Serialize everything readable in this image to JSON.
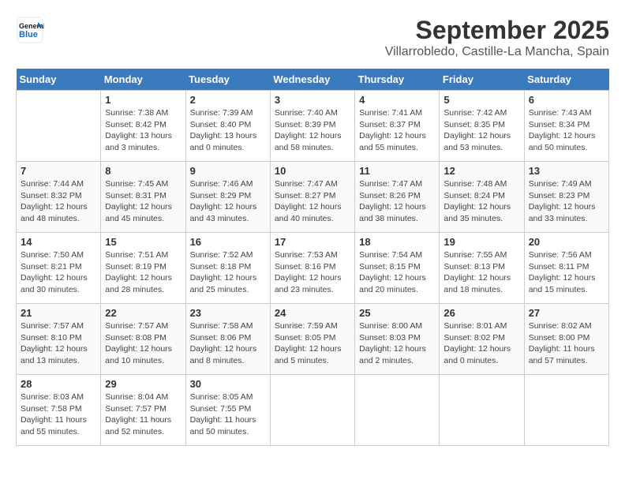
{
  "header": {
    "title": "September 2025",
    "subtitle": "Villarrobledo, Castille-La Mancha, Spain",
    "logo_line1": "General",
    "logo_line2": "Blue"
  },
  "days_of_week": [
    "Sunday",
    "Monday",
    "Tuesday",
    "Wednesday",
    "Thursday",
    "Friday",
    "Saturday"
  ],
  "weeks": [
    [
      {
        "day": "",
        "info": ""
      },
      {
        "day": "1",
        "info": "Sunrise: 7:38 AM\nSunset: 8:42 PM\nDaylight: 13 hours\nand 3 minutes."
      },
      {
        "day": "2",
        "info": "Sunrise: 7:39 AM\nSunset: 8:40 PM\nDaylight: 13 hours\nand 0 minutes."
      },
      {
        "day": "3",
        "info": "Sunrise: 7:40 AM\nSunset: 8:39 PM\nDaylight: 12 hours\nand 58 minutes."
      },
      {
        "day": "4",
        "info": "Sunrise: 7:41 AM\nSunset: 8:37 PM\nDaylight: 12 hours\nand 55 minutes."
      },
      {
        "day": "5",
        "info": "Sunrise: 7:42 AM\nSunset: 8:35 PM\nDaylight: 12 hours\nand 53 minutes."
      },
      {
        "day": "6",
        "info": "Sunrise: 7:43 AM\nSunset: 8:34 PM\nDaylight: 12 hours\nand 50 minutes."
      }
    ],
    [
      {
        "day": "7",
        "info": "Sunrise: 7:44 AM\nSunset: 8:32 PM\nDaylight: 12 hours\nand 48 minutes."
      },
      {
        "day": "8",
        "info": "Sunrise: 7:45 AM\nSunset: 8:31 PM\nDaylight: 12 hours\nand 45 minutes."
      },
      {
        "day": "9",
        "info": "Sunrise: 7:46 AM\nSunset: 8:29 PM\nDaylight: 12 hours\nand 43 minutes."
      },
      {
        "day": "10",
        "info": "Sunrise: 7:47 AM\nSunset: 8:27 PM\nDaylight: 12 hours\nand 40 minutes."
      },
      {
        "day": "11",
        "info": "Sunrise: 7:47 AM\nSunset: 8:26 PM\nDaylight: 12 hours\nand 38 minutes."
      },
      {
        "day": "12",
        "info": "Sunrise: 7:48 AM\nSunset: 8:24 PM\nDaylight: 12 hours\nand 35 minutes."
      },
      {
        "day": "13",
        "info": "Sunrise: 7:49 AM\nSunset: 8:23 PM\nDaylight: 12 hours\nand 33 minutes."
      }
    ],
    [
      {
        "day": "14",
        "info": "Sunrise: 7:50 AM\nSunset: 8:21 PM\nDaylight: 12 hours\nand 30 minutes."
      },
      {
        "day": "15",
        "info": "Sunrise: 7:51 AM\nSunset: 8:19 PM\nDaylight: 12 hours\nand 28 minutes."
      },
      {
        "day": "16",
        "info": "Sunrise: 7:52 AM\nSunset: 8:18 PM\nDaylight: 12 hours\nand 25 minutes."
      },
      {
        "day": "17",
        "info": "Sunrise: 7:53 AM\nSunset: 8:16 PM\nDaylight: 12 hours\nand 23 minutes."
      },
      {
        "day": "18",
        "info": "Sunrise: 7:54 AM\nSunset: 8:15 PM\nDaylight: 12 hours\nand 20 minutes."
      },
      {
        "day": "19",
        "info": "Sunrise: 7:55 AM\nSunset: 8:13 PM\nDaylight: 12 hours\nand 18 minutes."
      },
      {
        "day": "20",
        "info": "Sunrise: 7:56 AM\nSunset: 8:11 PM\nDaylight: 12 hours\nand 15 minutes."
      }
    ],
    [
      {
        "day": "21",
        "info": "Sunrise: 7:57 AM\nSunset: 8:10 PM\nDaylight: 12 hours\nand 13 minutes."
      },
      {
        "day": "22",
        "info": "Sunrise: 7:57 AM\nSunset: 8:08 PM\nDaylight: 12 hours\nand 10 minutes."
      },
      {
        "day": "23",
        "info": "Sunrise: 7:58 AM\nSunset: 8:06 PM\nDaylight: 12 hours\nand 8 minutes."
      },
      {
        "day": "24",
        "info": "Sunrise: 7:59 AM\nSunset: 8:05 PM\nDaylight: 12 hours\nand 5 minutes."
      },
      {
        "day": "25",
        "info": "Sunrise: 8:00 AM\nSunset: 8:03 PM\nDaylight: 12 hours\nand 2 minutes."
      },
      {
        "day": "26",
        "info": "Sunrise: 8:01 AM\nSunset: 8:02 PM\nDaylight: 12 hours\nand 0 minutes."
      },
      {
        "day": "27",
        "info": "Sunrise: 8:02 AM\nSunset: 8:00 PM\nDaylight: 11 hours\nand 57 minutes."
      }
    ],
    [
      {
        "day": "28",
        "info": "Sunrise: 8:03 AM\nSunset: 7:58 PM\nDaylight: 11 hours\nand 55 minutes."
      },
      {
        "day": "29",
        "info": "Sunrise: 8:04 AM\nSunset: 7:57 PM\nDaylight: 11 hours\nand 52 minutes."
      },
      {
        "day": "30",
        "info": "Sunrise: 8:05 AM\nSunset: 7:55 PM\nDaylight: 11 hours\nand 50 minutes."
      },
      {
        "day": "",
        "info": ""
      },
      {
        "day": "",
        "info": ""
      },
      {
        "day": "",
        "info": ""
      },
      {
        "day": "",
        "info": ""
      }
    ]
  ]
}
